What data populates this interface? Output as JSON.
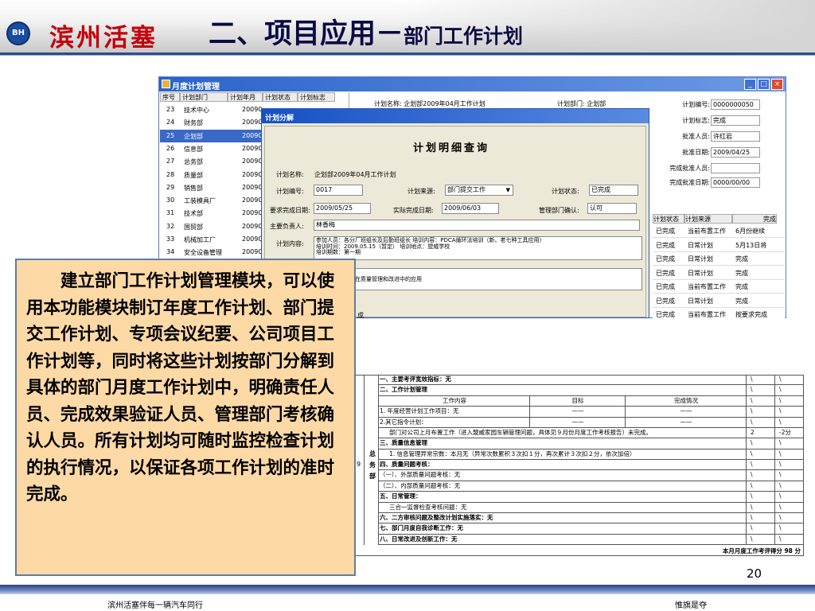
{
  "header": {
    "logo_badge": "BH",
    "logo_text": "滨州活塞",
    "title_main": "二、项目应用－",
    "title_sub": "部门工作计划"
  },
  "main_window": {
    "title": "月度计划管理",
    "buttons": [
      "_",
      "□",
      "×"
    ],
    "list": {
      "columns": [
        "序号",
        "计划部门",
        "计划年月",
        "计划状态",
        "计划标志"
      ],
      "rows": [
        {
          "no": "23",
          "dept": "技术中心",
          "ym": "20090"
        },
        {
          "no": "24",
          "dept": "财务部",
          "ym": "20090"
        },
        {
          "no": "25",
          "dept": "企划部",
          "ym": "20090",
          "selected": true
        },
        {
          "no": "26",
          "dept": "信息部",
          "ym": "20090"
        },
        {
          "no": "27",
          "dept": "总务部",
          "ym": "20090"
        },
        {
          "no": "28",
          "dept": "质量部",
          "ym": "20090"
        },
        {
          "no": "29",
          "dept": "销售部",
          "ym": "20090"
        },
        {
          "no": "30",
          "dept": "工装模具厂",
          "ym": "20090"
        },
        {
          "no": "31",
          "dept": "技术部",
          "ym": "20090"
        },
        {
          "no": "32",
          "dept": "国贸部",
          "ym": "20090"
        },
        {
          "no": "33",
          "dept": "机械加工厂",
          "ym": "20090"
        },
        {
          "no": "34",
          "dept": "安全设备管理",
          "ym": "20090"
        }
      ]
    },
    "behind_fields": {
      "plan_name_label": "计划名称:",
      "plan_name_value": "企划部2009年04月工作计划",
      "plan_dept_label": "计划部门:",
      "plan_dept_value": "企划部"
    },
    "right_panel": {
      "fields": [
        {
          "label": "计划编号:",
          "value": "0000000050"
        },
        {
          "label": "计划标志:",
          "value": "完成"
        },
        {
          "label": "批准人员:",
          "value": "许红岩"
        },
        {
          "label": "批准日期:",
          "value": "2009/04/25"
        },
        {
          "label": "完成批准人员:",
          "value": ""
        },
        {
          "label": "完成批准日期:",
          "value": "0000/00/00"
        }
      ],
      "table_columns": [
        "计划状态",
        "计划来源",
        "完成"
      ],
      "table_rows": [
        {
          "status": "已完成",
          "source": "当前布置工作",
          "extra": "6月份继续"
        },
        {
          "status": "已完成",
          "source": "日常计划",
          "extra": "5月13日将"
        },
        {
          "status": "已完成",
          "source": "日常计划",
          "extra": "完成"
        },
        {
          "status": "已完成",
          "source": "日常计划",
          "extra": "完成"
        },
        {
          "status": "已完成",
          "source": "当前布置工作",
          "extra": "完成"
        },
        {
          "status": "已完成",
          "source": "日常计划",
          "extra": "完成"
        },
        {
          "status": "已完成",
          "source": "当前布置工作",
          "extra": "按要求完成"
        },
        {
          "status": "已完成",
          "source": "日常计划",
          "extra": "完成"
        }
      ]
    }
  },
  "dialog": {
    "title": "计划分解",
    "heading": "计划明细查询",
    "plan_name_label": "计划名称:",
    "plan_name_value": "企划部2009年04月工作计划",
    "plan_no_label": "计划编号:",
    "plan_no_value": "0017",
    "plan_source_label": "计划来源:",
    "plan_source_value": "部门提交工作",
    "plan_status_label": "计划状态:",
    "plan_status_value": "已完成",
    "required_date_label": "要求完成日期:",
    "required_date_value": "2009/05/25",
    "actual_date_label": "实际完成日期:",
    "actual_date_value": "2009/06/03",
    "confirm_label": "管理部门确认:",
    "confirm_value": "认可",
    "owner_label": "主要负责人:",
    "owner_value": "林香梅",
    "content_label": "计划内容:",
    "content_lines": [
      "参加人员：各分厂班组长及后勤班组长    培训内容：PDCA循环法培训（新、老七种工具应用）",
      "培训时间：2009.05.15（暂定）           培训地点：盟威学校",
      "培训期数：第一期"
    ],
    "content2_lines": [
      "环法的应用",
      "新、老七种工具在质量管理和改进中的应用"
    ],
    "bottom_text": "成"
  },
  "doc_table": {
    "side_label_top": "总",
    "side_label_mid": "务",
    "side_label_bot": "部",
    "side_label_num": "9",
    "rows": [
      {
        "text": "一、主要考评宽效指标：无",
        "c1": "\\",
        "c2": "\\"
      },
      {
        "text": "二、工作计划管理",
        "c1": "\\",
        "c2": "\\"
      },
      {
        "text": "工作内容",
        "target": "目标",
        "status": "完成情况",
        "c1": "\\",
        "c2": "\\"
      },
      {
        "text": "1. 年度经营计划工作项目：无",
        "target": "——",
        "status": "——",
        "c1": "\\",
        "c2": "\\"
      },
      {
        "text": "2.其它指令计划：",
        "target": "——",
        "status": "——",
        "c1": "\\",
        "c2": "\\"
      },
      {
        "text": "部门对公司上月布置工作（进入盟威家园车辆管理问题，具体见９月份月度工作考核报告）未完成。",
        "c1": "2",
        "c2": "-2分"
      },
      {
        "text": "三、质量信息管理",
        "c1": "\\",
        "c2": "\\"
      },
      {
        "text": "1. 信息管理异常宗数：本月无（异常次数累积３次扣１分，再次累计３次扣２分，依次加倍）",
        "c1": "\\",
        "c2": "\\"
      },
      {
        "text": "四、质量问题考核：",
        "c1": "\\",
        "c2": "\\"
      },
      {
        "text": "（一）、外部质量问题考核：无",
        "c1": "\\",
        "c2": "\\"
      },
      {
        "text": "（二）、内部质量问题考核：无",
        "c1": "\\",
        "c2": "\\"
      },
      {
        "text": "五、日常管理：",
        "c1": "\\",
        "c2": "\\"
      },
      {
        "text": "三合一监督检查考核问题：无",
        "c1": "\\",
        "c2": "\\"
      },
      {
        "text": "六、二方审核问题及整改计划实施落实：无",
        "c1": "\\",
        "c2": "\\"
      },
      {
        "text": "七、部门月度自我诊断工作：无",
        "c1": "\\",
        "c2": "\\"
      },
      {
        "text": "八、日常改进及创新工作：无",
        "c1": "\\",
        "c2": "\\"
      }
    ],
    "summary": "本月月度工作考评得分 98 分"
  },
  "textbox": {
    "text": "建立部门工作计划管理模块，可以使用本功能模块制订年度工作计划、部门提交工作计划、专项会议纪要、公司项目工作计划等，同时将这些计划按部门分解到具体的部门月度工作计划中，明确责任人员、完成效果验证人员、管理部门考核确认人员。所有计划均可随时监控检查计划的执行情况，以保证各项工作计划的准时完成。"
  },
  "footer": {
    "page_number": "20",
    "left_text": "滨州活塞伴每一辆汽车同行",
    "right_text": "惟旗是夺"
  }
}
